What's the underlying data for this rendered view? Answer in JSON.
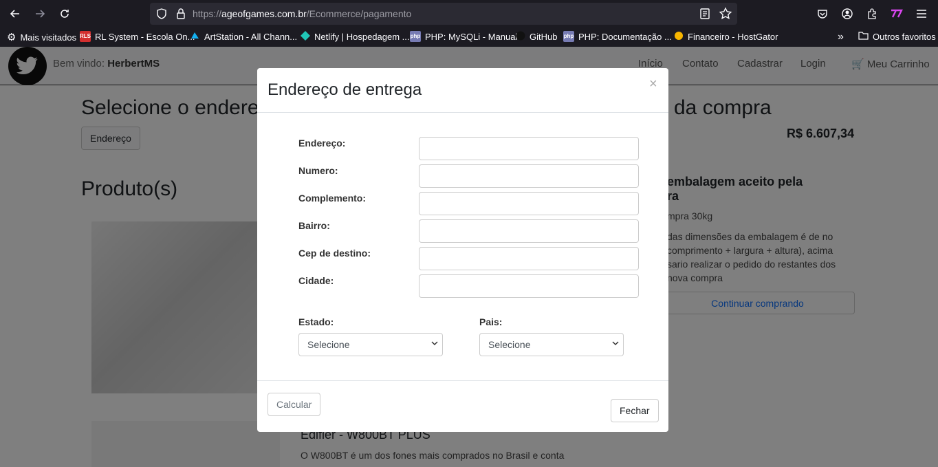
{
  "browser": {
    "url_scheme": "https://",
    "url_host": "ageofgames.com.br",
    "url_path": "/Ecommerce/pagamento",
    "bookmarks": [
      {
        "label": "Mais visitados",
        "icon": "gear-icon"
      },
      {
        "label": "RL System - Escola On...",
        "icon": "rls-favicon",
        "fav_text": "RLS",
        "fav_color": "#d32f2f"
      },
      {
        "label": "ArtStation - All Chann...",
        "icon": "artstation-favicon",
        "fav_text": "",
        "fav_color": "#13aff0"
      },
      {
        "label": "Netlify | Hospedagem ...",
        "icon": "netlify-favicon",
        "fav_text": "",
        "fav_color": "#20c6b7"
      },
      {
        "label": "PHP: MySQLi - Manual",
        "icon": "php-favicon",
        "fav_text": "php",
        "fav_color": "#777bb3"
      },
      {
        "label": "GitHub",
        "icon": "github-favicon"
      },
      {
        "label": "PHP: Documentação ...",
        "icon": "php-favicon",
        "fav_text": "php",
        "fav_color": "#777bb3"
      },
      {
        "label": "Financeiro - HostGator",
        "icon": "hostgator-favicon",
        "fav_text": "",
        "fav_color": "#f7b500"
      }
    ],
    "other_bookmarks": "Outros favoritos"
  },
  "navbar": {
    "welcome_prefix": "Bem vindo:",
    "username": "HerbertMS",
    "links": [
      "Início",
      "Contato",
      "Cadastrar",
      "Login"
    ],
    "cart": "Meu Carrinho"
  },
  "page": {
    "heading_left": "Selecione o endere",
    "heading_right": "da compra",
    "address_button": "Endereço",
    "total": "R$ 6.607,34",
    "products_heading": "Produto(s)",
    "side_heading_l1": "embalagem aceito pela",
    "side_heading_l2": "ra",
    "side_weight": "mpra 30kg",
    "side_text_l1": "das dimensões da embalagem é de no",
    "side_text_l2": "comprimento + largura + altura), acima",
    "side_text_l3": "sario realizar o pedido do restantes dos",
    "side_text_l4": "nova compra",
    "continue_button": "Continuar comprando",
    "product2_title": "Edifier - W800BT PLUS",
    "product2_desc": "O W800BT é um dos fones mais comprados no Brasil e conta"
  },
  "modal": {
    "title": "Endereço de entrega",
    "close_symbol": "×",
    "fields": [
      {
        "label": "Endereço:",
        "value": ""
      },
      {
        "label": "Numero:",
        "value": ""
      },
      {
        "label": "Complemento:",
        "value": ""
      },
      {
        "label": "Bairro:",
        "value": ""
      },
      {
        "label": "Cep de destino:",
        "value": ""
      },
      {
        "label": "Cidade:",
        "value": ""
      }
    ],
    "state_label": "Estado:",
    "state_value": "Selecione",
    "country_label": "Pais:",
    "country_value": "Selecione",
    "calc_button": "Calcular",
    "close_button": "Fechar"
  }
}
